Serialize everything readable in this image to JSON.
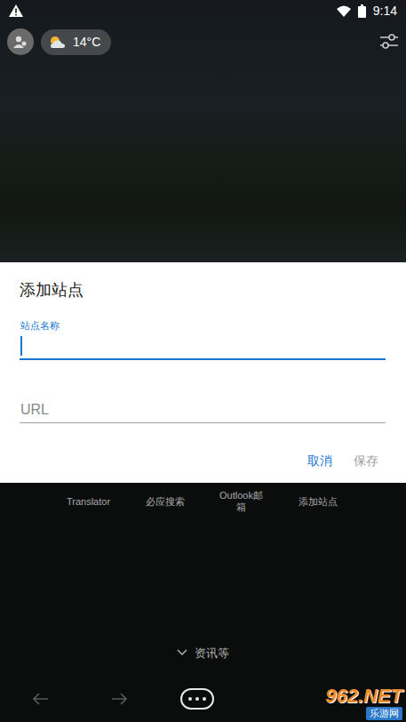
{
  "status_bar": {
    "time": "9:14"
  },
  "header": {
    "temperature": "14°C"
  },
  "dialog": {
    "title": "添加站点",
    "fields": [
      {
        "label": "站点名称",
        "value": "",
        "focused": true
      },
      {
        "placeholder": "URL",
        "value": "",
        "focused": false
      }
    ],
    "buttons": [
      {
        "label": "取消",
        "disabled": false
      },
      {
        "label": "保存",
        "disabled": true
      }
    ]
  },
  "sites": [
    {
      "label": "Translator"
    },
    {
      "label": "必应搜索"
    },
    {
      "label": "Outlook邮箱"
    },
    {
      "label": "添加站点"
    }
  ],
  "more": {
    "label": "资讯等"
  },
  "watermark": {
    "number": "962.NET",
    "site": "乐游网"
  }
}
